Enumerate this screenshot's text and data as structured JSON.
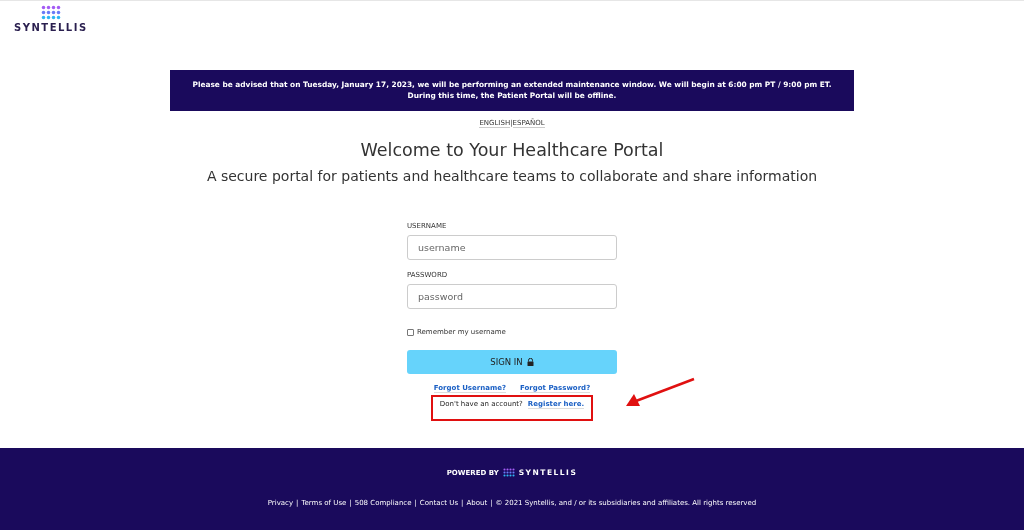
{
  "header": {
    "logo_text": "SYNTELLIS"
  },
  "notice": "Please be advised that on Tuesday, January 17, 2023, we will be performing an extended maintenance window. We will begin at 6:00 pm PT / 9:00 pm ET. During this time, the Patient Portal will be offline.",
  "languages": {
    "items": [
      "ENGLISH",
      "ESPAÑOL"
    ],
    "separator": "|"
  },
  "title": "Welcome to Your Healthcare Portal",
  "subtitle": "A secure portal for patients and healthcare teams to collaborate and share information",
  "form": {
    "username_label": "USERNAME",
    "username_placeholder": "username",
    "password_label": "PASSWORD",
    "password_placeholder": "password",
    "remember": {
      "label": "Remember my username",
      "checked": false
    },
    "sign_in": "SIGN IN",
    "forgot_links": [
      "Forgot Username?",
      "Forgot Password?"
    ],
    "register_prompt": "Don't have an account?",
    "register_link": "Register here."
  },
  "footer": {
    "powered_by": "POWERED BY",
    "logo_text": "SYNTELLIS",
    "links": [
      "Privacy",
      "Terms of Use",
      "508 Compliance",
      "Contact Us",
      "About"
    ],
    "separator": "|",
    "copyright": "© 2021 Syntellis, and / or its subsidiaries and affiliates. All rights reserved"
  }
}
